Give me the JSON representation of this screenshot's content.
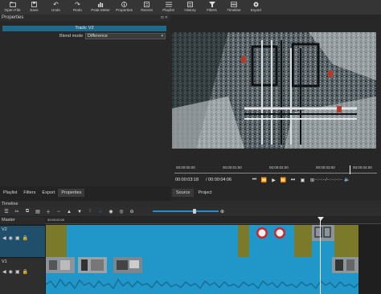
{
  "toolbar": {
    "items": [
      {
        "label": "Open File",
        "icon": "open-file-icon"
      },
      {
        "label": "Save",
        "icon": "save-icon"
      },
      {
        "label": "Undo",
        "icon": "undo-icon"
      },
      {
        "label": "Redo",
        "icon": "redo-icon"
      },
      {
        "label": "Peak Meter",
        "icon": "peak-meter-icon"
      },
      {
        "label": "Properties",
        "icon": "properties-icon"
      },
      {
        "label": "Recent",
        "icon": "recent-icon"
      },
      {
        "label": "Playlist",
        "icon": "playlist-icon"
      },
      {
        "label": "History",
        "icon": "history-icon"
      },
      {
        "label": "Filters",
        "icon": "filters-icon"
      },
      {
        "label": "Timeline",
        "icon": "timeline-icon"
      },
      {
        "label": "Export",
        "icon": "export-icon"
      }
    ]
  },
  "properties": {
    "title": "Properties",
    "track_name": "Track: V2",
    "blend_mode_label": "Blend mode",
    "blend_mode_value": "Difference"
  },
  "player": {
    "scrub_labels": [
      "00:00:00:00",
      "00:00:01:00",
      "00:00:02:00",
      "00:00:03:00",
      "00:00:04:00"
    ],
    "current_timecode": "00:00:03:18",
    "duration": "/ 00:00:04:06",
    "in_out": "--:--:--:--/--:--:--:--",
    "tabs": [
      "Source",
      "Project"
    ]
  },
  "dock_tabs": [
    "Playlist",
    "Filters",
    "Export",
    "Properties"
  ],
  "timeline": {
    "title": "Timeline",
    "master_label": "Master",
    "ruler_start": "00:00:00:00",
    "tracks": [
      {
        "name": "V2"
      },
      {
        "name": "V1"
      }
    ]
  },
  "colors": {
    "accent": "#1f6a8a",
    "clip_blue": "#2196c8",
    "clip_olive": "#7a7a2a",
    "selected_track": "#1f4f6b"
  }
}
